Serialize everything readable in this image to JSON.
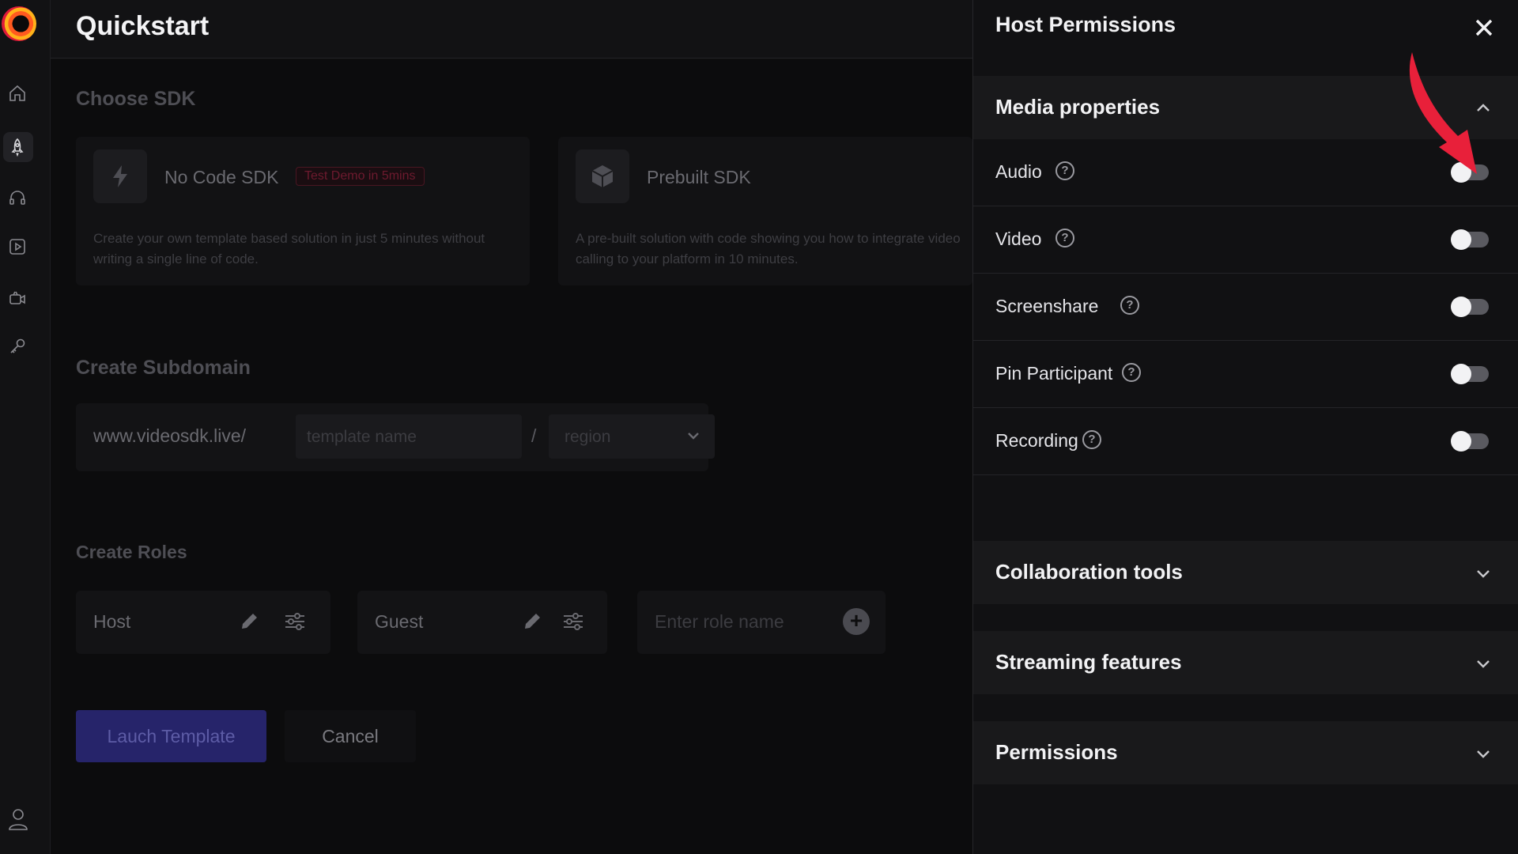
{
  "app": {
    "page_title": "Quickstart"
  },
  "sidebar": {
    "items": [
      {
        "name": "home",
        "icon": "home-icon"
      },
      {
        "name": "quickstart",
        "icon": "rocket-icon",
        "active": true
      },
      {
        "name": "support",
        "icon": "headphones-icon"
      },
      {
        "name": "media",
        "icon": "play-icon"
      },
      {
        "name": "live-stream",
        "icon": "camera-icon"
      },
      {
        "name": "api-keys",
        "icon": "key-icon"
      }
    ],
    "profile_icon": "user-icon"
  },
  "choose_sdk": {
    "heading": "Choose SDK",
    "cards": [
      {
        "name": "No Code SDK",
        "icon": "lightning-icon",
        "badge": "Test Demo in 5mins",
        "description": "Create your own template based solution in just 5 minutes without writing a single line of code."
      },
      {
        "name": "Prebuilt SDK",
        "icon": "cube-icon",
        "description": "A pre-built solution with code showing you how to integrate video calling to your platform in 10 minutes."
      }
    ]
  },
  "subdomain": {
    "heading": "Create Subdomain",
    "prefix": "www.videosdk.live/",
    "template_placeholder": "template name",
    "separator": "/",
    "region_placeholder": "region"
  },
  "roles": {
    "heading": "Create Roles",
    "items": [
      {
        "name": "Host"
      },
      {
        "name": "Guest"
      }
    ],
    "new_role_placeholder": "Enter role name"
  },
  "actions": {
    "launch": "Lauch Template",
    "cancel": "Cancel"
  },
  "panel": {
    "title": "Host Permissions",
    "sections": [
      {
        "title": "Media properties",
        "expanded": true,
        "permissions": [
          {
            "label": "Audio",
            "enabled": false
          },
          {
            "label": "Video",
            "enabled": false
          },
          {
            "label": "Screenshare",
            "enabled": false
          },
          {
            "label": "Pin Participant",
            "enabled": false
          },
          {
            "label": "Recording",
            "enabled": false
          }
        ]
      },
      {
        "title": "Collaboration tools",
        "expanded": false
      },
      {
        "title": "Streaming features",
        "expanded": false
      },
      {
        "title": "Permissions",
        "expanded": false
      }
    ]
  },
  "colors": {
    "accent_button": "#26246a",
    "annotation_arrow": "#e8203a",
    "toggle_off_track": "#5a5a60"
  }
}
